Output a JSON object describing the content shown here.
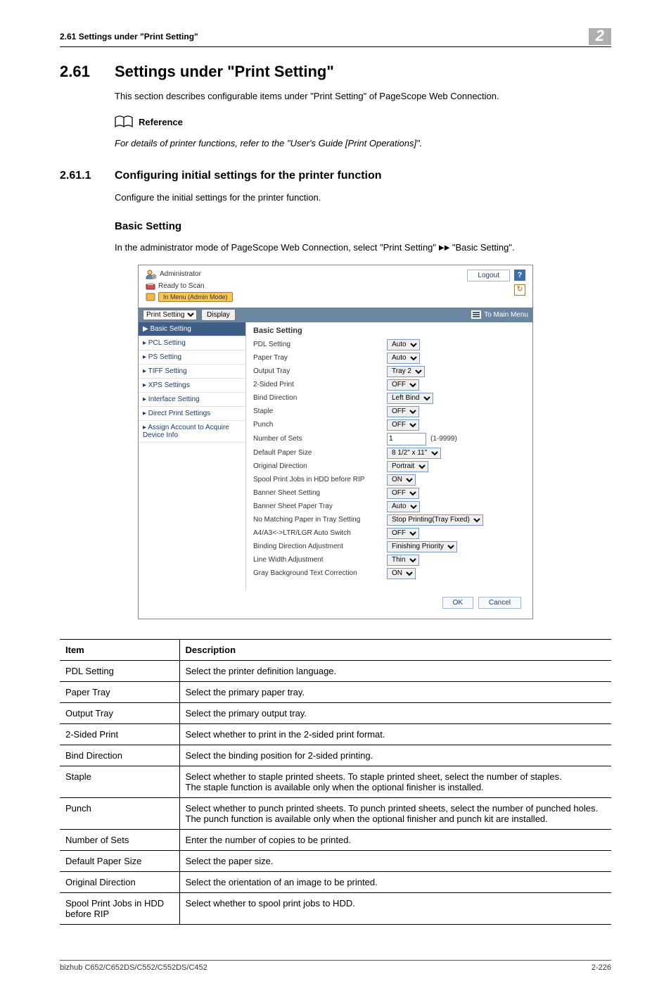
{
  "header": {
    "running": "2.61    Settings under \"Print Setting\"",
    "chapter": "2"
  },
  "section": {
    "number": "2.61",
    "title": "Settings under \"Print Setting\"",
    "intro": "This section describes configurable items under \"Print Setting\" of PageScope Web Connection.",
    "reference_label": "Reference",
    "reference_text": "For details of printer functions, refer to the \"User's Guide [Print Operations]\"."
  },
  "subsection": {
    "number": "2.61.1",
    "title": "Configuring initial settings for the printer function",
    "intro": "Configure the initial settings for the printer function."
  },
  "block": {
    "title": "Basic Setting",
    "intro_pre": "In the administrator mode of PageScope Web Connection, select \"Print Setting\" ",
    "intro_arrow": "►►",
    "intro_post": " \"Basic Setting\"."
  },
  "webui": {
    "administrator": "Administrator",
    "ready": "Ready to Scan",
    "mode": "In Menu (Admin Mode)",
    "logout": "Logout",
    "help": "?",
    "refresh": "↻",
    "dropdown": "Print Setting",
    "display": "Display",
    "mainmenu": "To Main Menu",
    "sidebar": [
      "Basic Setting",
      "PCL Setting",
      "PS Setting",
      "TIFF Setting",
      "XPS Settings",
      "Interface Setting",
      "Direct Print Settings",
      "Assign Account to Acquire Device Info"
    ],
    "content_heading": "Basic Setting",
    "rows": [
      {
        "label": "PDL Setting",
        "value": "Auto"
      },
      {
        "label": "Paper Tray",
        "value": "Auto"
      },
      {
        "label": "Output Tray",
        "value": "Tray 2"
      },
      {
        "label": "2-Sided Print",
        "value": "OFF"
      },
      {
        "label": "Bind Direction",
        "value": "Left Bind"
      },
      {
        "label": "Staple",
        "value": "OFF"
      },
      {
        "label": "Punch",
        "value": "OFF"
      },
      {
        "label": "Number of Sets",
        "value": "1",
        "input": true,
        "range": "(1-9999)"
      },
      {
        "label": "Default Paper Size",
        "value": "8 1/2\" x 11\""
      },
      {
        "label": "Original Direction",
        "value": "Portrait"
      },
      {
        "label": "Spool Print Jobs in HDD before RIP",
        "value": "ON"
      },
      {
        "label": "Banner Sheet Setting",
        "value": "OFF"
      },
      {
        "label": "Banner Sheet Paper Tray",
        "value": "Auto"
      },
      {
        "label": "No Matching Paper in Tray Setting",
        "value": "Stop Printing(Tray Fixed)"
      },
      {
        "label": "A4/A3<->LTR/LGR Auto Switch",
        "value": "OFF"
      },
      {
        "label": "Binding Direction Adjustment",
        "value": "Finishing Priority"
      },
      {
        "label": "Line Width Adjustment",
        "value": "Thin"
      },
      {
        "label": "Gray Background Text Correction",
        "value": "ON"
      }
    ],
    "ok": "OK",
    "cancel": "Cancel"
  },
  "table": {
    "head_item": "Item",
    "head_desc": "Description",
    "rows": [
      {
        "item": "PDL Setting",
        "desc": "Select the printer definition language."
      },
      {
        "item": "Paper Tray",
        "desc": "Select the primary paper tray."
      },
      {
        "item": "Output Tray",
        "desc": "Select the primary output tray."
      },
      {
        "item": "2-Sided Print",
        "desc": "Select whether to print in the 2-sided print format."
      },
      {
        "item": "Bind Direction",
        "desc": "Select the binding position for 2-sided printing."
      },
      {
        "item": "Staple",
        "desc": "Select whether to staple printed sheets. To staple printed sheet, select the number of staples.\nThe staple function is available only when the optional finisher is installed."
      },
      {
        "item": "Punch",
        "desc": "Select whether to punch printed sheets. To punch printed sheets, select the number of punched holes.\nThe punch function is available only when the optional finisher and punch kit are installed."
      },
      {
        "item": "Number of Sets",
        "desc": "Enter the number of copies to be printed."
      },
      {
        "item": "Default Paper Size",
        "desc": "Select the paper size."
      },
      {
        "item": "Original Direction",
        "desc": "Select the orientation of an image to be printed."
      },
      {
        "item": "Spool Print Jobs in HDD before RIP",
        "desc": "Select whether to spool print jobs to HDD."
      }
    ]
  },
  "footer": {
    "left": "bizhub C652/C652DS/C552/C552DS/C452",
    "right": "2-226"
  }
}
